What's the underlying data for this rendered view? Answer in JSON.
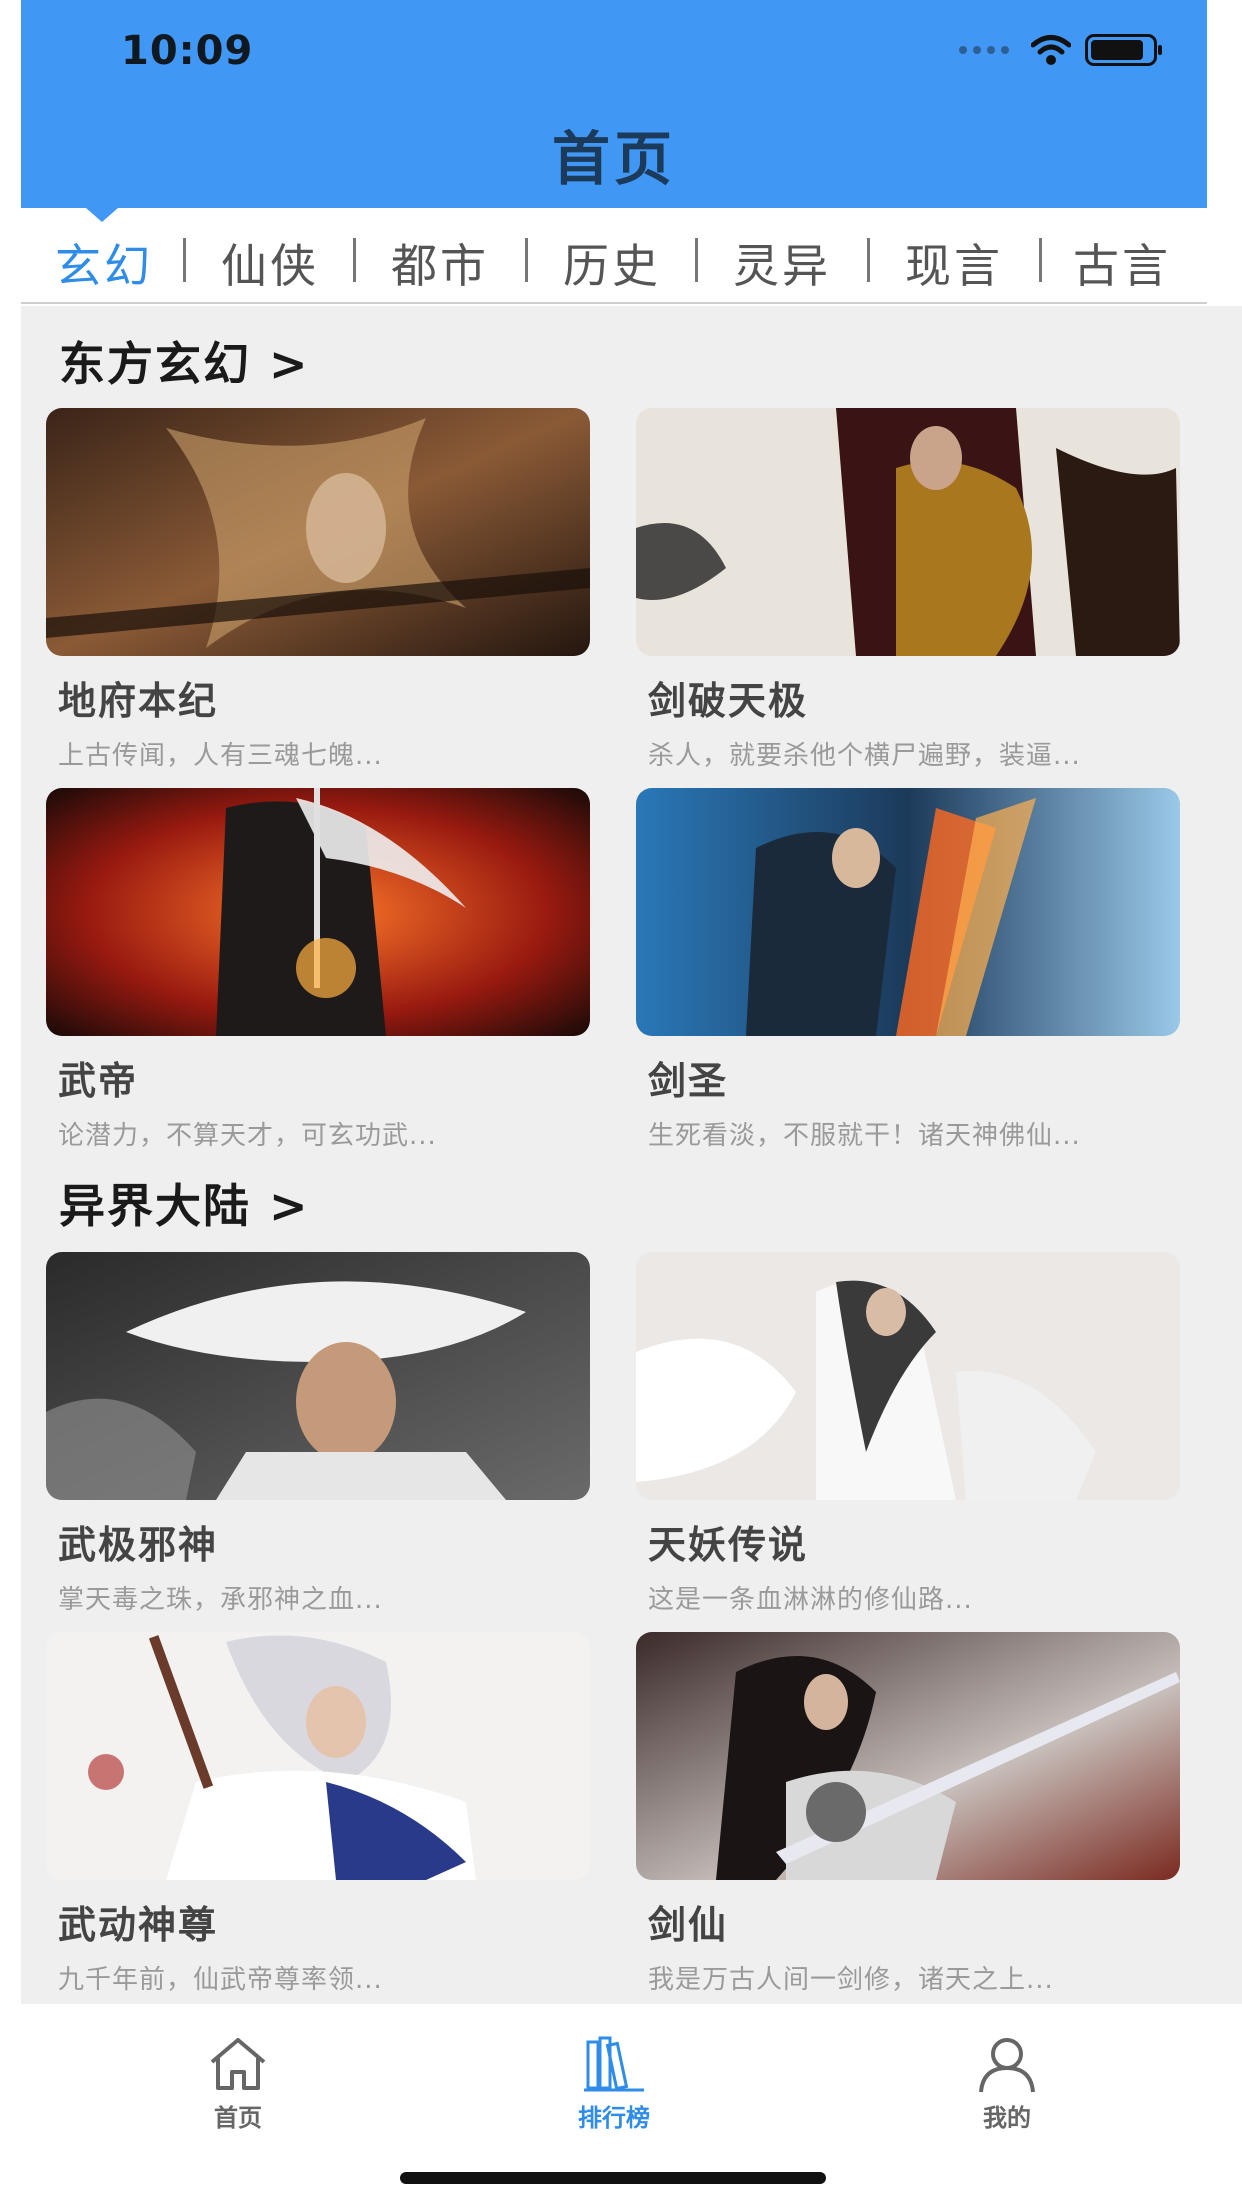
{
  "status_bar": {
    "time": "10:09"
  },
  "header": {
    "title": "首页"
  },
  "category_tabs": [
    {
      "label": "玄幻",
      "active": true
    },
    {
      "label": "仙侠"
    },
    {
      "label": "都市"
    },
    {
      "label": "历史"
    },
    {
      "label": "灵异"
    },
    {
      "label": "现言"
    },
    {
      "label": "古言"
    }
  ],
  "sections": [
    {
      "title": "东方玄幻 >",
      "books": [
        {
          "title": "地府本纪",
          "desc": "上古传闻，人有三魂七魄..."
        },
        {
          "title": "剑破天极",
          "desc": "杀人，就要杀他个横尸遍野，装逼..."
        },
        {
          "title": "武帝",
          "desc": "论潜力，不算天才，可玄功武..."
        },
        {
          "title": "剑圣",
          "desc": "生死看淡，不服就干！诸天神佛仙..."
        }
      ]
    },
    {
      "title": "异界大陆 >",
      "books": [
        {
          "title": "武极邪神",
          "desc": "掌天毒之珠，承邪神之血..."
        },
        {
          "title": "天妖传说",
          "desc": "这是一条血淋淋的修仙路..."
        },
        {
          "title": "武动神尊",
          "desc": "九千年前，仙武帝尊率领..."
        },
        {
          "title": "剑仙",
          "desc": "我是万古人间一剑修，诸天之上..."
        }
      ]
    }
  ],
  "tabbar": [
    {
      "label": "首页",
      "icon": "home-icon",
      "active": false
    },
    {
      "label": "排行榜",
      "icon": "ranking-books-icon",
      "active": true
    },
    {
      "label": "我的",
      "icon": "user-icon",
      "active": false
    }
  ],
  "colors": {
    "accent": "#4197f4",
    "active_text": "#2f8de8",
    "content_bg": "#efefef"
  }
}
